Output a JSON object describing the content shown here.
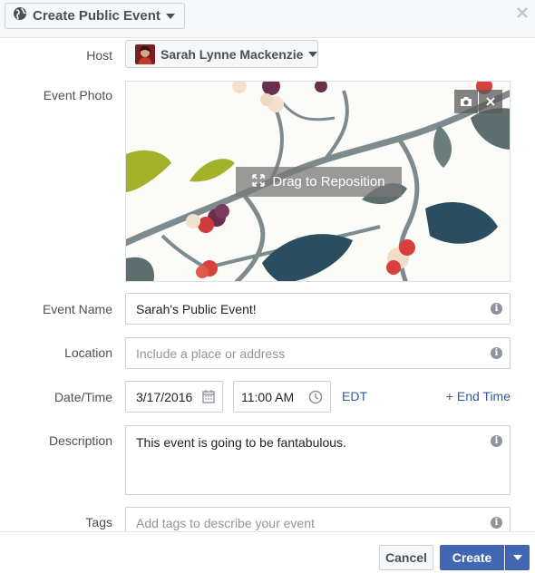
{
  "header": {
    "event_type_label": "Create Public Event",
    "close_icon": "close-icon",
    "globe_icon": "globe-icon"
  },
  "host": {
    "label": "Host",
    "name": "Sarah Lynne Mackenzie"
  },
  "photo": {
    "label": "Event Photo",
    "drag_hint": "Drag to Reposition",
    "camera_icon": "camera-icon",
    "remove_icon": "close-icon"
  },
  "event_name": {
    "label": "Event Name",
    "value": "Sarah's Public Event!"
  },
  "location": {
    "label": "Location",
    "placeholder": "Include a place or address"
  },
  "datetime": {
    "label": "Date/Time",
    "date": "3/17/2016",
    "time": "11:00 AM",
    "timezone": "EDT",
    "end_time_link": "+ End Time"
  },
  "description": {
    "label": "Description",
    "value": "This event is going to be fantabulous."
  },
  "tags": {
    "label": "Tags",
    "placeholder": "Add tags to describe your event"
  },
  "footer": {
    "cancel": "Cancel",
    "create": "Create"
  },
  "colors": {
    "accent": "#4267b2",
    "link": "#365899",
    "label_text": "#4b4f56",
    "placeholder": "#90949c"
  }
}
